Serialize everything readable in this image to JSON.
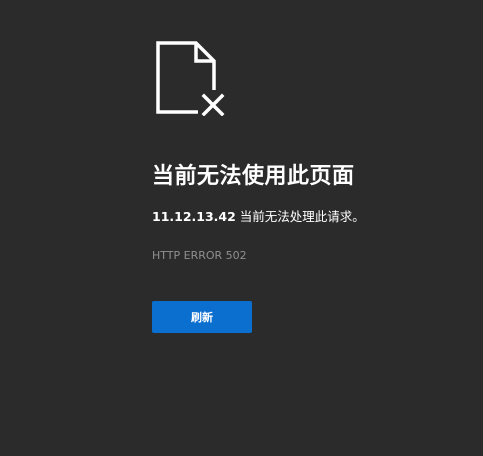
{
  "error_page": {
    "icon": "document-error-icon",
    "title": "当前无法使用此页面",
    "host": "11.12.13.42",
    "message": " 当前无法处理此请求。",
    "error_code": "HTTP ERROR 502",
    "reload_label": "刷新"
  },
  "colors": {
    "background": "#2b2b2b",
    "text": "#ffffff",
    "muted": "#8f8f8f",
    "button": "#0b6fd0"
  }
}
